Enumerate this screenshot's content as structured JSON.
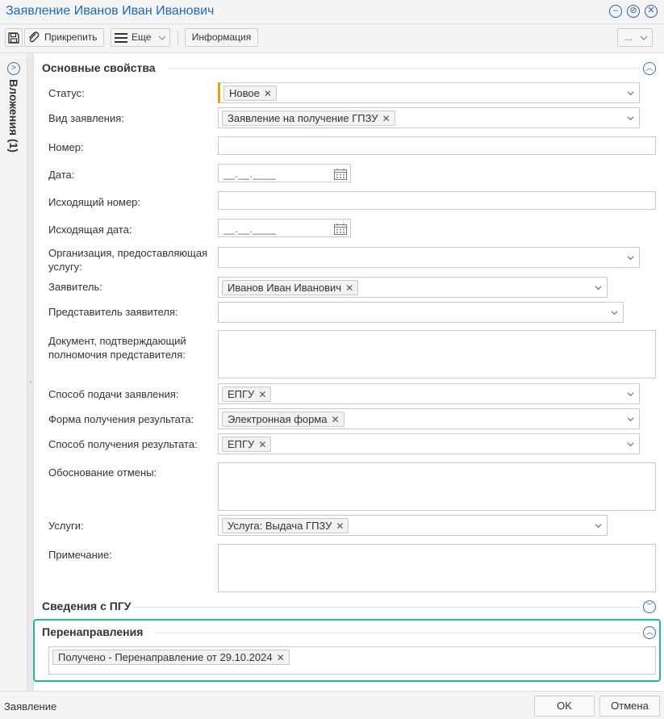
{
  "window": {
    "title": "Заявление Иванов Иван Иванович"
  },
  "toolbar": {
    "attach_label": "Прикрепить",
    "more_label": "Еще",
    "info_label": "Информация",
    "overflow_label": "..."
  },
  "sidepanel": {
    "attachments_label": "Вложения (1)"
  },
  "sections": {
    "main": "Основные свойства",
    "pgu": "Сведения с ПГУ",
    "redirects": "Перенаправления"
  },
  "form": {
    "status": {
      "label": "Статус:",
      "tag": "Новое"
    },
    "app_type": {
      "label": "Вид заявления:",
      "tag": "Заявление на получение ГПЗУ"
    },
    "number": {
      "label": "Номер:",
      "value": ""
    },
    "date": {
      "label": "Дата:",
      "mask": "__.__.____"
    },
    "out_number": {
      "label": "Исходящий номер:",
      "value": ""
    },
    "out_date": {
      "label": "Исходящая дата:",
      "mask": "__.__.____"
    },
    "org": {
      "label_line1": "Организация, предоставляющая",
      "label_line2": "услугу:"
    },
    "applicant": {
      "label": "Заявитель:",
      "tag": "Иванов Иван Иванович"
    },
    "representative": {
      "label": "Представитель заявителя:"
    },
    "authority_doc": {
      "label_line1": "Документ, подтверждающий",
      "label_line2": "полномочия представителя:"
    },
    "submit_method": {
      "label": "Способ подачи заявления:",
      "tag": "ЕПГУ"
    },
    "result_form": {
      "label": "Форма получения результата:",
      "tag": "Электронная форма"
    },
    "result_method": {
      "label": "Способ получения результата:",
      "tag": "ЕПГУ"
    },
    "cancel_reason": {
      "label": "Обоснование отмены:"
    },
    "services": {
      "label": "Услуги:",
      "tag": "Услуга: Выдача ГПЗУ"
    },
    "note": {
      "label": "Примечание:"
    }
  },
  "redirects": {
    "tag": "Получено - Перенаправление от 29.10.2024"
  },
  "footer": {
    "label": "Заявление",
    "ok_label": "OK",
    "cancel_label": "Отмена"
  },
  "colors": {
    "title_blue": "#1e6ab0",
    "required_marker": "#e0a020",
    "highlight_border": "#2bb39a"
  }
}
